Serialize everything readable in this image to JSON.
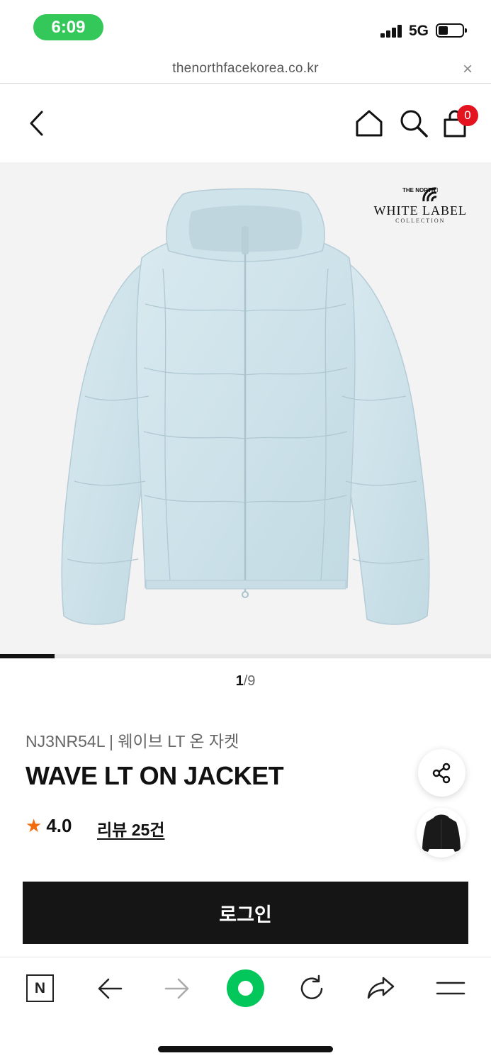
{
  "status_bar": {
    "time": "6:09",
    "network": "5G",
    "battery_level": 0.4
  },
  "url_bar": {
    "url": "thenorthfacekorea.co.kr",
    "close_glyph": "×"
  },
  "header": {
    "back_icon": "chevron-left-icon",
    "home_icon": "home-icon",
    "search_icon": "search-icon",
    "cart_icon": "shopping-bag-icon",
    "cart_count": "0",
    "badge_color": "#e3131f"
  },
  "product_image": {
    "brand_logo": "THE NORTH FACE",
    "brand_line": "WHITE LABEL",
    "brand_sub": "COLLECTION",
    "progress_fraction": 0.111
  },
  "pager": {
    "current": "1",
    "total": "/9"
  },
  "product": {
    "code_line": "NJ3NR54L | 웨이브 LT 온 자켓",
    "name": "WAVE LT ON JACKET",
    "rating_star": "★",
    "rating": "4.0",
    "review_link": "리뷰 25건",
    "rating_color": "#f26c0d"
  },
  "actions": {
    "share_icon": "share-icon",
    "login_label": "로그인"
  },
  "toolbar": {
    "n_label": "N",
    "items": [
      "back-arrow-icon",
      "forward-arrow-icon",
      "home-dot-icon",
      "reload-icon",
      "share-arrow-icon",
      "menu-icon"
    ],
    "accent": "#03c75a"
  }
}
